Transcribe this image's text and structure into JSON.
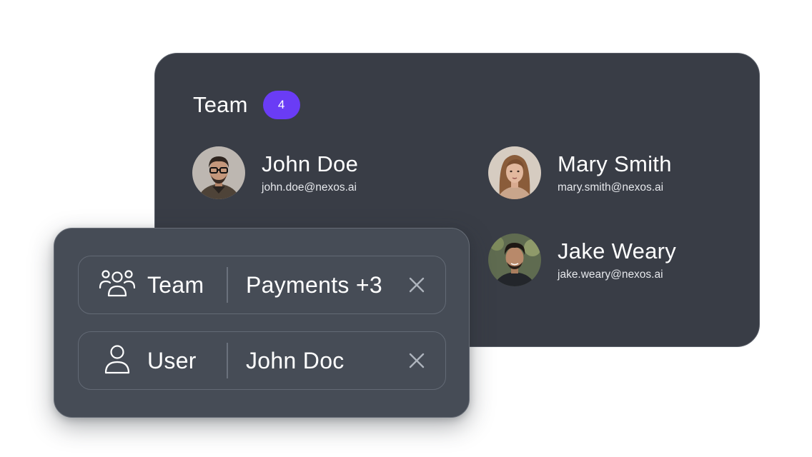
{
  "team_card": {
    "title": "Team",
    "badge_count": "4",
    "badge_color": "#6a3cf5",
    "members": [
      {
        "name": "John Doe",
        "email": "john.doe@nexos.ai",
        "avatar": "avatar-photo-john-doe"
      },
      {
        "name": "Mary Smith",
        "email": "mary.smith@nexos.ai",
        "avatar": "avatar-photo-mary-smith"
      },
      {
        "name": "Jake Weary",
        "email": "jake.weary@nexos.ai",
        "avatar": "avatar-photo-jake-weary"
      }
    ]
  },
  "filters": [
    {
      "icon": "team-icon",
      "label": "Team",
      "value": "Payments +3",
      "remove_icon": "close-icon"
    },
    {
      "icon": "user-icon",
      "label": "User",
      "value": "John Doc",
      "remove_icon": "close-icon"
    }
  ]
}
